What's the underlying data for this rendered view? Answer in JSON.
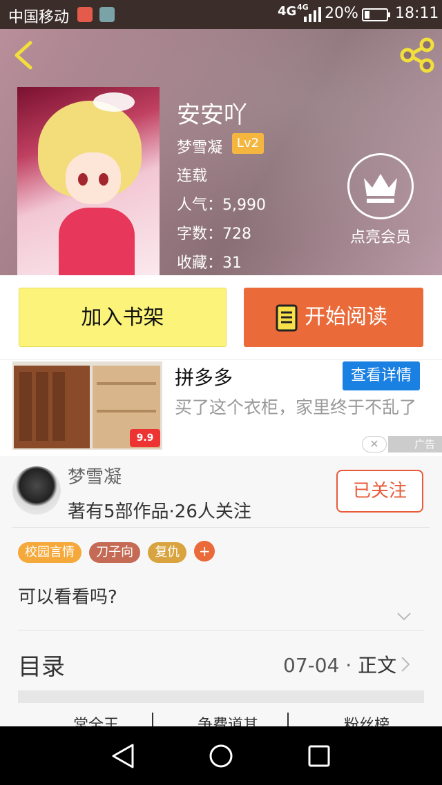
{
  "status_bar": {
    "carrier": "中国移动",
    "network": "4G",
    "network_small": "4G",
    "battery": "20%",
    "time": "18:11"
  },
  "book": {
    "title": "安安吖",
    "author": "梦雪凝",
    "level": "Lv2",
    "status": "连载",
    "stats": [
      "人气：5,990",
      "字数：728",
      "收藏：31"
    ]
  },
  "vip": {
    "label": "点亮会员"
  },
  "actions": {
    "add_shelf": "加入书架",
    "start_read": "开始阅读"
  },
  "ad": {
    "title": "拼多多",
    "button": "查看详情",
    "desc": "买了这个衣柜，家里终于不乱了",
    "price_tag": "9.9",
    "ad_label": "广告"
  },
  "author_info": {
    "name": "梦雪凝",
    "meta": "著有5部作品·26人关注",
    "follow": "已关注"
  },
  "tags": [
    {
      "label": "校园言情",
      "color": "#f5a93a"
    },
    {
      "label": "刀子向",
      "color": "#c46a55"
    },
    {
      "label": "复仇",
      "color": "#d9a43f"
    }
  ],
  "intro": "可以看看吗?",
  "toc": {
    "title": "目录",
    "latest": "07-04 · ",
    "latest_type": "正文"
  },
  "cut_row": [
    "常全王",
    "争费道其",
    "粉丝榜"
  ],
  "colors": {
    "accent": "#ea6a3a",
    "shelf": "#fbf37a",
    "follow": "#e85a38",
    "ad_button": "#1a80e2"
  }
}
